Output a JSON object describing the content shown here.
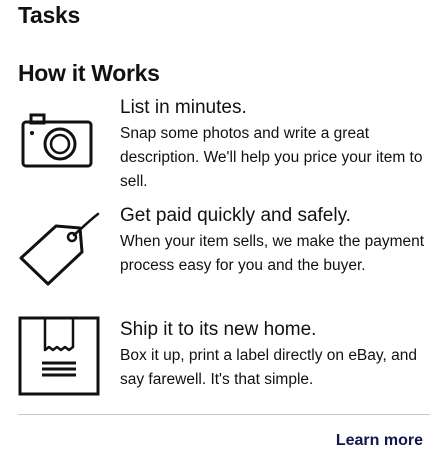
{
  "page": {
    "tasks_title": "Tasks",
    "section_title": "How it Works"
  },
  "steps": [
    {
      "icon": "camera-icon",
      "heading": "List in minutes.",
      "description": "Snap some photos and write a great description. We'll help you price your item to sell."
    },
    {
      "icon": "price-tag-icon",
      "heading": "Get paid quickly and safely.",
      "description": "When your item sells, we make the payment process easy for you and the buyer."
    },
    {
      "icon": "shipping-box-icon",
      "heading": "Ship it to its new home.",
      "description": "Box it up, print a label directly on eBay, and say farewell. It's that simple."
    }
  ],
  "footer": {
    "learn_more_label": "Learn more"
  },
  "colors": {
    "text": "#111111",
    "link": "#13174d",
    "divider": "#c7c7c7"
  }
}
